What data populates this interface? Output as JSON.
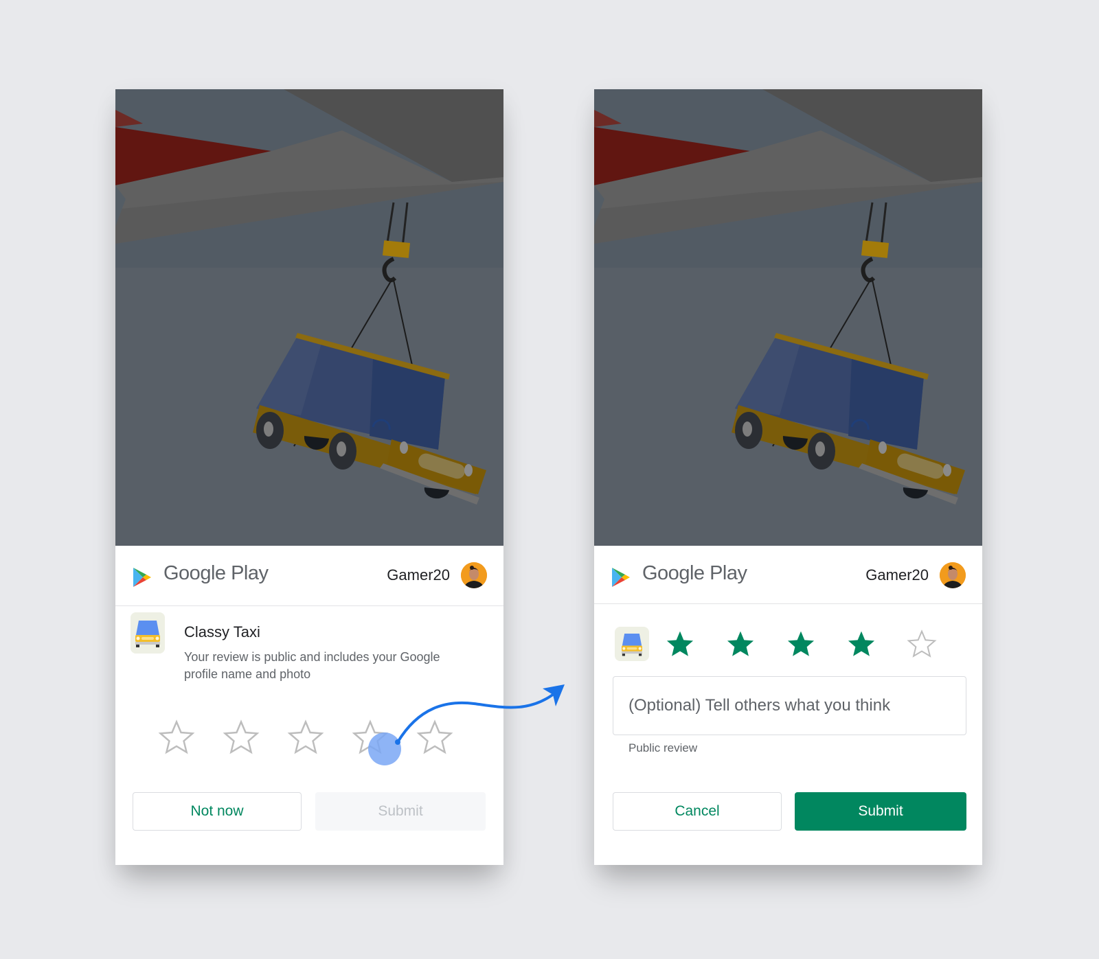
{
  "screens": {
    "before": {
      "header": {
        "brand": "Google Play",
        "username": "Gamer20",
        "avatar_icon": "user-avatar"
      },
      "app": {
        "name": "Classy Taxi",
        "description": "Your review is public and includes your Google profile name and photo",
        "icon": "taxi-app-icon"
      },
      "rating": {
        "selected": 0,
        "max": 5,
        "touch_target_star": 4
      },
      "buttons": {
        "secondary": "Not now",
        "primary": "Submit",
        "primary_disabled": true
      }
    },
    "after": {
      "header": {
        "brand": "Google Play",
        "username": "Gamer20",
        "avatar_icon": "user-avatar"
      },
      "app": {
        "icon": "taxi-app-icon"
      },
      "rating": {
        "selected": 4,
        "max": 5
      },
      "review_field": {
        "value": "",
        "placeholder": "(Optional) Tell others what you think",
        "helper": "Public review"
      },
      "buttons": {
        "secondary": "Cancel",
        "primary": "Submit",
        "primary_disabled": false
      }
    }
  },
  "colors": {
    "accent_green": "#01875f",
    "star_empty": "#bdbdbd",
    "touch_indicator": "#7aa7f5",
    "flow_arrow": "#1a73e8",
    "page_background": "#e8e9ec"
  },
  "annotation": {
    "flow_arrow_icon": "curved-arrow-right"
  }
}
